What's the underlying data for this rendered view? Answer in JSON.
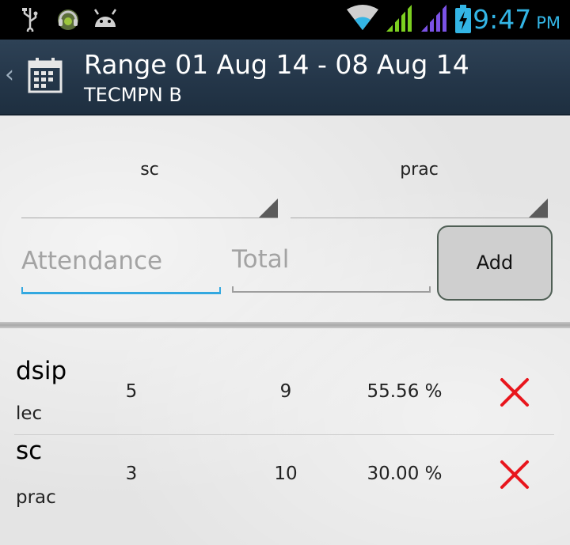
{
  "status_bar": {
    "time": "9:47",
    "ampm": "PM",
    "icons": [
      "usb-icon",
      "headset-app-icon",
      "android-icon",
      "wifi-icon",
      "signal-icon",
      "signal-icon",
      "battery-charging-icon"
    ],
    "accent_color": "#33b5e5"
  },
  "action_bar": {
    "title": "Range 01 Aug 14 - 08 Aug 14",
    "subtitle": "TECMPN B",
    "up_icon": "chevron-left-icon",
    "app_icon": "calendar-icon"
  },
  "form": {
    "subject_spinner": {
      "selected": "sc"
    },
    "type_spinner": {
      "selected": "prac"
    },
    "attendance_input": {
      "value": "",
      "placeholder": "Attendance"
    },
    "total_input": {
      "value": "",
      "placeholder": "Total"
    },
    "add_button": "Add"
  },
  "records": [
    {
      "subject": "dsip",
      "type": "lec",
      "attended": "5",
      "total": "9",
      "percentage": "55.56 %",
      "delete_icon": "delete-x-icon"
    },
    {
      "subject": "sc",
      "type": "prac",
      "attended": "3",
      "total": "10",
      "percentage": "30.00 %",
      "delete_icon": "delete-x-icon"
    }
  ],
  "colors": {
    "action_bar": "#243649",
    "delete": "#e8161d",
    "focus_line": "#33a8e0"
  }
}
